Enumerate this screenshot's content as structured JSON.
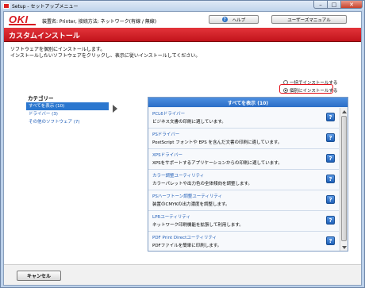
{
  "window": {
    "title": "Setup - セットアップメニュー"
  },
  "header": {
    "logo": "OKI",
    "device_name": "装置名: Printer, 接続方法: ネットワーク(有線 / 無線)",
    "help_label": "ヘルプ",
    "manual_label": "ユーザーズマニュアル"
  },
  "banner": {
    "title": "カスタムインストール"
  },
  "intro": {
    "line1": "ソフトウェアを個別にインストールします。",
    "line2": "インストールしたいソフトウェアをクリックし、表示に従いインストールしてください。"
  },
  "install_mode": {
    "all_label": "一括でインストールする",
    "individual_label": "個別にインストールする",
    "selected": "individual"
  },
  "category": {
    "title": "カテゴリー",
    "items": [
      {
        "label": "すべてを表示 (10)",
        "selected": true
      },
      {
        "label": "ドライバー (3)",
        "selected": false
      },
      {
        "label": "その他のソフトウェア (7)",
        "selected": false
      }
    ]
  },
  "software": {
    "header": "すべてを表示 (10)",
    "items": [
      {
        "name": "PCL6ドライバー",
        "desc": "ビジネス文書の印刷に適しています。"
      },
      {
        "name": "PSドライバー",
        "desc": "PostScript フォントや EPS を含んだ文書の印刷に適しています。"
      },
      {
        "name": "XPSドライバー",
        "desc": "XPSをサポートするアプリケーションからの印刷に適しています。"
      },
      {
        "name": "カラー調整ユーティリティ",
        "desc": "カラーパレットや出力色の全体傾向を調整します。"
      },
      {
        "name": "PSハーフトーン調整ユーティリティ",
        "desc": "装置のCMYKの出力濃度を調整します。"
      },
      {
        "name": "LPRユーティリティ",
        "desc": "ネットワーク印刷機能を拡張して利用します。"
      },
      {
        "name": "PDF Print Directユーティリティ",
        "desc": "PDFファイルを簡単に印刷します。"
      }
    ],
    "help_icon": "?"
  },
  "footer": {
    "cancel_label": "キャンセル"
  }
}
